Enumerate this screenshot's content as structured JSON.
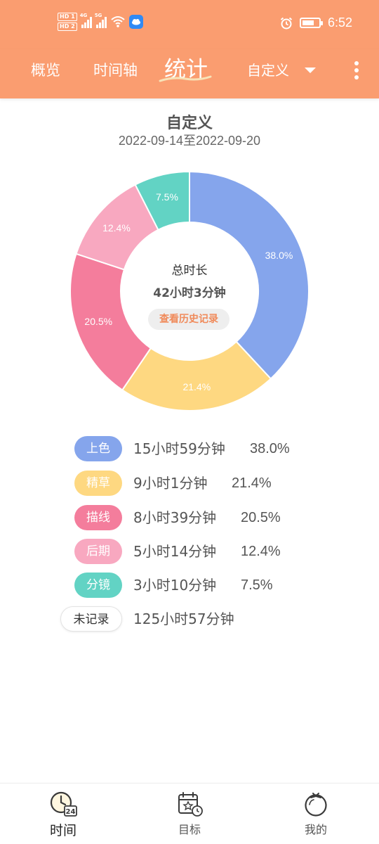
{
  "status_bar": {
    "sim1": "HD 1",
    "sim2": "HD 2",
    "net1": "4G",
    "net2": "5G",
    "time": "6:52"
  },
  "nav": {
    "tabs": [
      "概览",
      "时间轴",
      "统计"
    ],
    "active_tab": "统计",
    "filter_label": "自定义"
  },
  "header": {
    "title": "自定义",
    "date_range": "2022-09-14至2022-09-20"
  },
  "donut": {
    "center_title": "总时长",
    "center_value": "42小时3分钟",
    "history_button": "查看历史记录"
  },
  "chart_data": {
    "type": "pie",
    "donut": true,
    "categories": [
      "上色",
      "精草",
      "描线",
      "后期",
      "分镜"
    ],
    "values": [
      38.0,
      21.4,
      20.5,
      12.4,
      7.5
    ],
    "labels": [
      "38.0%",
      "21.4%",
      "20.5%",
      "12.4%",
      "7.5%"
    ],
    "colors": [
      "#85a5ec",
      "#fed881",
      "#f47d9c",
      "#f8a8c0",
      "#62d3c4"
    ]
  },
  "legend": [
    {
      "label": "上色",
      "duration": "15小时59分钟",
      "percent": "38.0%",
      "color": "#85a5ec"
    },
    {
      "label": "精草",
      "duration": "9小时1分钟",
      "percent": "21.4%",
      "color": "#fed881"
    },
    {
      "label": "描线",
      "duration": "8小时39分钟",
      "percent": "20.5%",
      "color": "#f47d9c"
    },
    {
      "label": "后期",
      "duration": "5小时14分钟",
      "percent": "12.4%",
      "color": "#f8a8c0"
    },
    {
      "label": "分镜",
      "duration": "3小时10分钟",
      "percent": "7.5%",
      "color": "#62d3c4"
    },
    {
      "label": "未记录",
      "duration": "125小时57分钟",
      "percent": "",
      "color": "#ffffff"
    }
  ],
  "bottom_nav": {
    "items": [
      "时间",
      "目标",
      "我的"
    ],
    "active": "时间",
    "clock_badge": "24"
  },
  "colors": {
    "accent": "#fa9d70",
    "history_text": "#f08a5a"
  }
}
